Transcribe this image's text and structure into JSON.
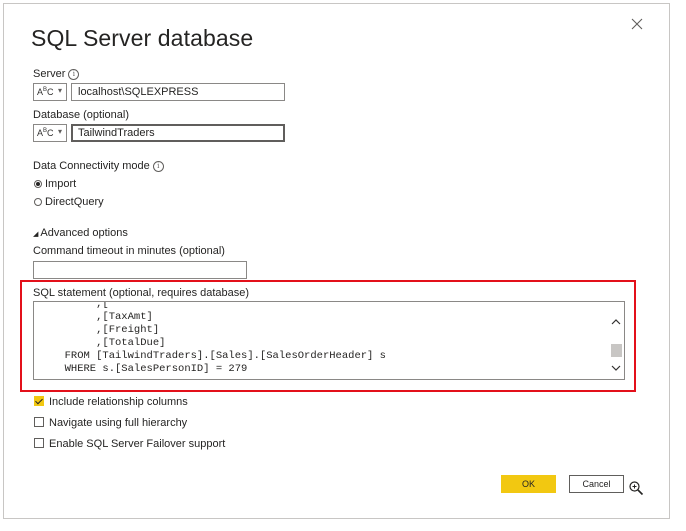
{
  "dialog": {
    "title": "SQL Server database",
    "close_icon": "close-icon"
  },
  "server": {
    "label": "Server",
    "type_label": "A",
    "type_sup": "B",
    "type_sub": "C",
    "value": "localhost\\SQLEXPRESS"
  },
  "database": {
    "label": "Database (optional)",
    "type_label": "A",
    "type_sup": "B",
    "type_sub": "C",
    "value": "TailwindTraders"
  },
  "connectivity": {
    "label": "Data Connectivity mode",
    "options": [
      {
        "label": "Import",
        "checked": true
      },
      {
        "label": "DirectQuery",
        "checked": false
      }
    ]
  },
  "advanced": {
    "label": "Advanced options",
    "timeout_label": "Command timeout in minutes (optional)",
    "timeout_value": "",
    "sql_label": "SQL statement (optional, requires database)",
    "sql_lines": [
      "       ,[",
      "       ,[TaxAmt]",
      "       ,[Freight]",
      "       ,[TotalDue]",
      "  FROM [TailwindTraders].[Sales].[SalesOrderHeader] s",
      "  WHERE s.[SalesPersonID] = 279"
    ]
  },
  "options": [
    {
      "label": "Include relationship columns",
      "checked": true
    },
    {
      "label": "Navigate using full hierarchy",
      "checked": false
    },
    {
      "label": "Enable SQL Server Failover support",
      "checked": false
    }
  ],
  "buttons": {
    "ok": "OK",
    "cancel": "Cancel"
  },
  "colors": {
    "accent": "#f2c811",
    "highlight": "#e3101a"
  }
}
